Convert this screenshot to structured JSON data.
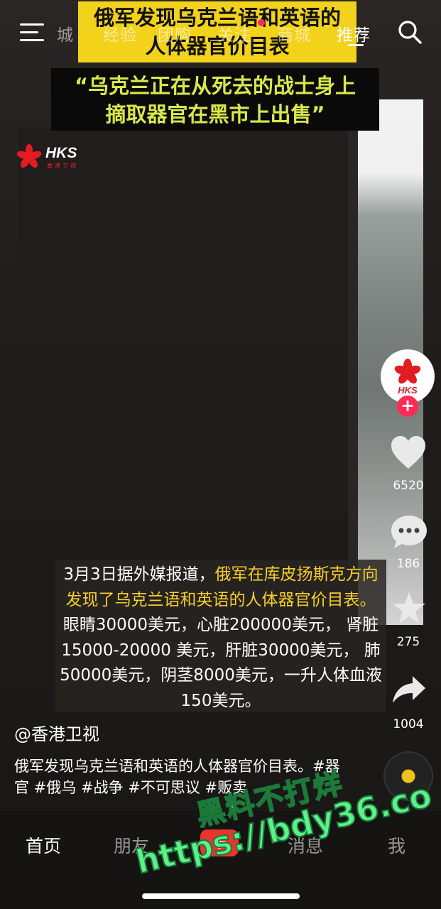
{
  "top_nav": {
    "tabs": [
      {
        "label": "城"
      },
      {
        "label": "经验"
      },
      {
        "label": "团购"
      },
      {
        "label": "关注"
      },
      {
        "label": "商城"
      },
      {
        "label": "推荐",
        "active": true
      }
    ]
  },
  "banner": {
    "line1": "俄军发现乌克兰语和英语的",
    "line2": "人体器官价目表",
    "quote_line1": "“乌克兰正在从死去的战士身上",
    "quote_line2": "摘取器官在黑市上出售”"
  },
  "logo": {
    "name": "HKS",
    "subtitle": "香港卫视"
  },
  "caption": {
    "part1": "3月3日据外媒报道，",
    "highlight": "俄军在库皮扬斯克方向发现了乌克兰语和英语的人体器官价目表。",
    "part2": "眼睛30000美元，心脏200000美元， 肾脏15000-20000 美元，肝脏30000美元， 肺50000美元，阴茎8000美元，一升人体血液 150美元。"
  },
  "rail": {
    "likes": "6520",
    "comments": "186",
    "favorites": "275",
    "shares": "1004",
    "avatar_label": "HKS"
  },
  "author": "@香港卫视",
  "description": "俄军发现乌克兰语和英语的人体器官价目表。#器官 #俄乌 #战争 #不可思议 #贩卖",
  "bottom_nav": {
    "home": "首页",
    "friends": "朋友",
    "plus": "+",
    "messages": "消息",
    "me": "我"
  },
  "watermark": {
    "line1": "黑料不打烊",
    "line2": "https://bdy36.co"
  },
  "colors": {
    "banner_yellow": "#f2d21b",
    "caption_highlight": "#f5cf2b",
    "quote_text": "#d9e84a",
    "accent_red": "#fe2c55",
    "watermark_green": "#5ef08a"
  }
}
